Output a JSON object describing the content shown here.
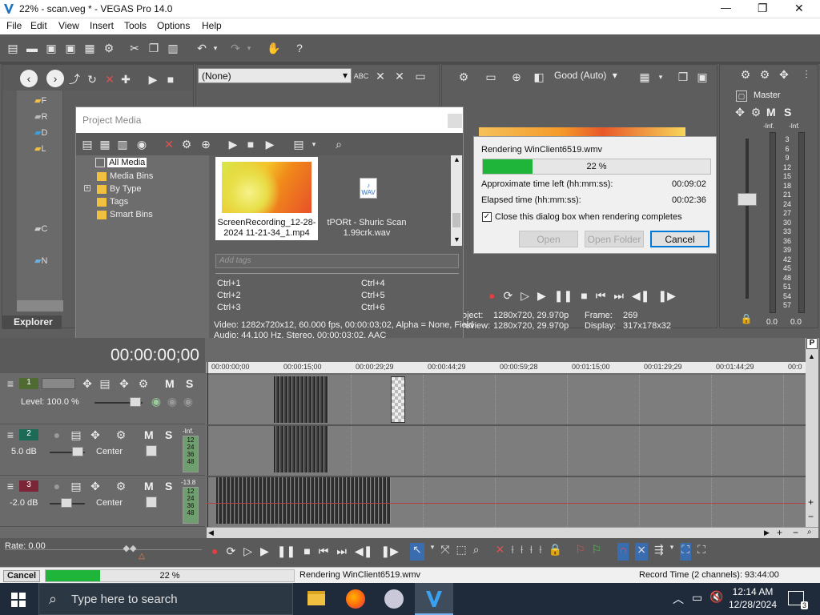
{
  "window": {
    "title": "22% - scan.veg * - VEGAS Pro 14.0",
    "controls": {
      "minimize": "—",
      "maximize": "❐",
      "close": "✕"
    }
  },
  "menu": [
    "File",
    "Edit",
    "View",
    "Insert",
    "Tools",
    "Options",
    "Help"
  ],
  "trimmer": {
    "dropdown": "(None)"
  },
  "preview": {
    "quality": "Good (Auto)",
    "project_label": "oject:",
    "project_value": "1280x720, 29.970p",
    "preview_label": "Preview:",
    "preview_value": "1280x720, 29.970p",
    "frame_label": "Frame:",
    "frame_value": "269",
    "display_label": "Display:",
    "display_value": "317x178x32"
  },
  "master": {
    "title": "Master",
    "m": "M",
    "s": "S",
    "inf_left": "-Inf.",
    "inf_right": "-Inf.",
    "scale": [
      "3",
      "6",
      "9",
      "12",
      "15",
      "18",
      "21",
      "24",
      "27",
      "30",
      "33",
      "36",
      "39",
      "42",
      "45",
      "48",
      "51",
      "54",
      "57"
    ],
    "val_left": "0.0",
    "val_right": "0.0"
  },
  "explorer": {
    "tab": "Explorer",
    "tree_letters": [
      "F",
      "R",
      "D",
      "L",
      "C",
      "N"
    ]
  },
  "project_media": {
    "title": "Project Media",
    "tree": [
      "All Media",
      "Media Bins",
      "By Type",
      "Tags",
      "Smart Bins"
    ],
    "items": [
      {
        "name": "ScreenRecording_12-28-2024 11-21-34_1.mp4"
      },
      {
        "name": "tPORt - Shuric Scan 1.99crk.wav"
      }
    ],
    "tags_placeholder": "Add tags",
    "shortcuts": [
      "Ctrl+1",
      "Ctrl+2",
      "Ctrl+3",
      "Ctrl+4",
      "Ctrl+5",
      "Ctrl+6"
    ],
    "video_info": "Video: 1282x720x12, 60.000 fps, 00:00:03;02, Alpha = None, Field",
    "audio_info": "Audio: 44,100 Hz, Stereo, 00:00:03;02, AAC"
  },
  "render_dialog": {
    "title": "Rendering WinClient6519.wmv",
    "progress": 22,
    "progress_text": "22 %",
    "time_left_label": "Approximate time left (hh:mm:ss):",
    "time_left": "00:09:02",
    "elapsed_label": "Elapsed time (hh:mm:ss):",
    "elapsed": "00:02:36",
    "checkbox_label": "Close this dialog box when rendering completes",
    "checkbox_checked": true,
    "open_btn": "Open",
    "open_folder_btn": "Open Folder",
    "cancel_btn": "Cancel"
  },
  "timeline": {
    "timecode": "00:00:00;00",
    "ruler": [
      "00:00:00;00",
      "00:00:15;00",
      "00:00:29;29",
      "00:00:44;29",
      "00:00:59;28",
      "00:01:15;00",
      "00:01:29;29",
      "00:01:44;29",
      "00:0"
    ],
    "tracks": [
      {
        "num": "1",
        "level": "Level: 100.0 %"
      },
      {
        "num": "2",
        "vol": "5.0 dB",
        "pan": "Center",
        "meter_top": "-Inf.",
        "meter_scale": [
          "12",
          "24",
          "36",
          "48"
        ]
      },
      {
        "num": "3",
        "vol": "-2.0 dB",
        "pan": "Center",
        "meter_top": "-13.8",
        "meter_scale": [
          "12",
          "24",
          "36",
          "48"
        ]
      }
    ],
    "rate": "Rate: 0.00",
    "marker_p": "P"
  },
  "statusbar": {
    "cancel": "Cancel",
    "progress": 22,
    "progress_text": "22 %",
    "message": "Rendering WinClient6519.wmv",
    "record_time": "Record Time (2 channels): 93:44:00"
  },
  "taskbar": {
    "search_placeholder": "Type here to search",
    "time": "12:14 AM",
    "date": "12/28/2024",
    "notification_count": "3"
  },
  "colors": {
    "render_progress": "#1eb53a",
    "video_track": "#4f6b32",
    "audio_track_2": "#1d6b57",
    "audio_track_3": "#7a2638"
  }
}
